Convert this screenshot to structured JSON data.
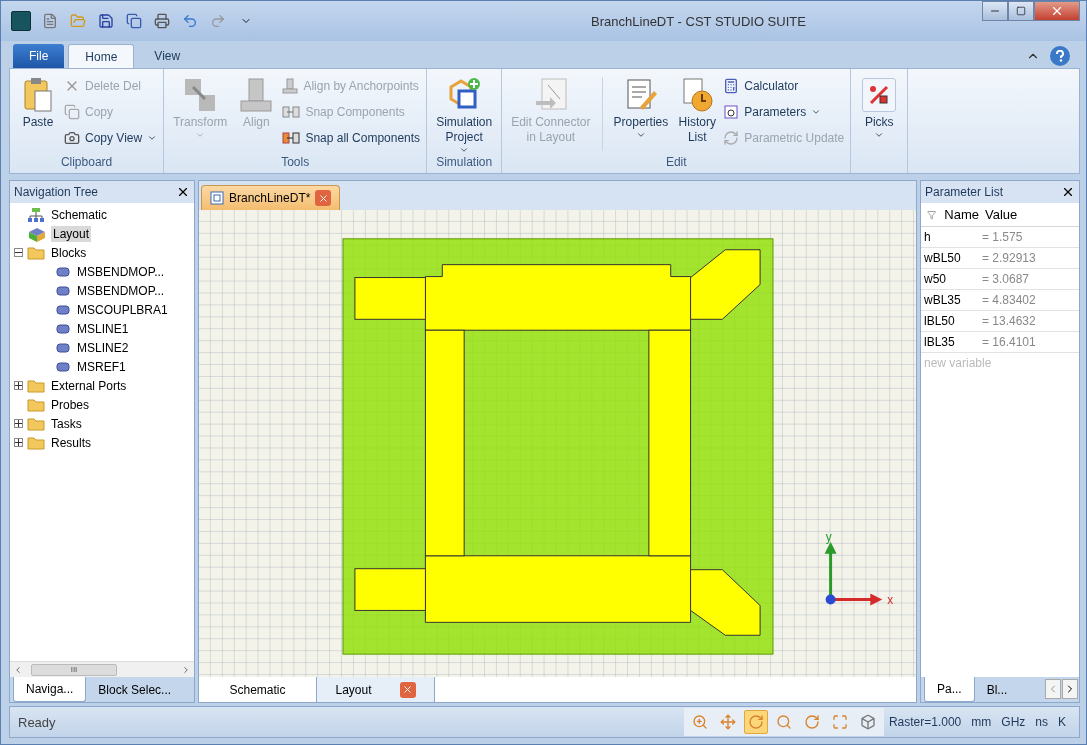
{
  "window": {
    "title": "BranchLineDT - CST STUDIO SUITE"
  },
  "ribbon_tabs": [
    {
      "label": "File",
      "kind": "file",
      "selected": false
    },
    {
      "label": "Home",
      "kind": "tab",
      "selected": true
    },
    {
      "label": "View",
      "kind": "tab",
      "selected": false
    }
  ],
  "ribbon_groups": [
    {
      "label": "Clipboard",
      "items": [
        {
          "kind": "large",
          "lines": [
            "Paste"
          ],
          "disabled": false,
          "dropdown": false
        },
        {
          "kind": "small",
          "label": "Delete Del",
          "disabled": true,
          "dropdown": false
        },
        {
          "kind": "small",
          "label": "Copy",
          "disabled": true,
          "dropdown": false
        },
        {
          "kind": "small",
          "label": "Copy View",
          "disabled": false,
          "dropdown": true
        }
      ]
    },
    {
      "label": "Tools",
      "items": [
        {
          "kind": "large",
          "lines": [
            "Transform"
          ],
          "disabled": true,
          "dropdown": true
        },
        {
          "kind": "large",
          "lines": [
            "Align"
          ],
          "disabled": true,
          "dropdown": false
        },
        {
          "kind": "small",
          "label": "Align by Anchorpoints",
          "disabled": true,
          "dropdown": false
        },
        {
          "kind": "small",
          "label": "Snap Components",
          "disabled": true,
          "dropdown": false
        },
        {
          "kind": "small",
          "label": "Snap all Components",
          "disabled": false,
          "dropdown": false
        }
      ]
    },
    {
      "label": "Simulation",
      "items": [
        {
          "kind": "large",
          "lines": [
            "Simulation",
            "Project"
          ],
          "disabled": false,
          "dropdown": true
        }
      ]
    },
    {
      "label": "Edit",
      "items": [
        {
          "kind": "large",
          "lines": [
            "Edit Connector",
            "in Layout"
          ],
          "disabled": true,
          "dropdown": false
        },
        {
          "kind": "separator"
        },
        {
          "kind": "large",
          "lines": [
            "Properties"
          ],
          "disabled": false,
          "dropdown": true
        },
        {
          "kind": "large",
          "lines": [
            "History",
            "List"
          ],
          "disabled": false,
          "dropdown": false
        },
        {
          "kind": "small",
          "label": "Calculator",
          "disabled": false,
          "dropdown": false
        },
        {
          "kind": "small",
          "label": "Parameters",
          "disabled": false,
          "dropdown": true
        },
        {
          "kind": "small",
          "label": "Parametric Update",
          "disabled": true,
          "dropdown": false
        }
      ]
    },
    {
      "items": [
        {
          "kind": "large",
          "lines": [
            "Picks"
          ],
          "disabled": false,
          "dropdown": true
        }
      ]
    }
  ],
  "navigation_tree": {
    "title": "Navigation Tree",
    "items": [
      {
        "kind": "schematic",
        "label": "Schematic",
        "selected": false
      },
      {
        "kind": "layout",
        "label": "Layout",
        "selected": true
      },
      {
        "kind": "folder",
        "label": "Blocks",
        "selected": false,
        "expanded": true,
        "children": [
          {
            "kind": "block",
            "label": "MSBENDMOP...",
            "selected": false
          },
          {
            "kind": "block",
            "label": "MSBENDMOP...",
            "selected": false
          },
          {
            "kind": "block",
            "label": "MSCOUPLBRA1",
            "selected": false
          },
          {
            "kind": "block",
            "label": "MSLINE1",
            "selected": false
          },
          {
            "kind": "block",
            "label": "MSLINE2",
            "selected": false
          },
          {
            "kind": "block",
            "label": "MSREF1",
            "selected": false
          }
        ]
      },
      {
        "kind": "folder",
        "label": "External Ports",
        "selected": false,
        "expanded": false
      },
      {
        "kind": "folder",
        "label": "Probes",
        "selected": false
      },
      {
        "kind": "folder",
        "label": "Tasks",
        "selected": false,
        "expanded": false
      },
      {
        "kind": "folder",
        "label": "Results",
        "selected": false,
        "expanded": false
      }
    ],
    "scroll_grip": "III",
    "tabs": [
      {
        "label": "Naviga...",
        "selected": true
      },
      {
        "label": "Block Selec...",
        "selected": false
      }
    ]
  },
  "document": {
    "tab": "BranchLineDT*",
    "axes": {
      "y": "y",
      "x": "x"
    },
    "view_tabs": [
      {
        "label": "Schematic",
        "selected": true,
        "closable": false
      },
      {
        "label": "Layout",
        "selected": false,
        "closable": true
      }
    ]
  },
  "parameter_list": {
    "title": "Parameter List",
    "columns": [
      "Name",
      "Value"
    ],
    "rows": [
      {
        "name": "h",
        "value": "= 1.575"
      },
      {
        "name": "wBL50",
        "value": "= 2.92913"
      },
      {
        "name": "w50",
        "value": "= 3.0687"
      },
      {
        "name": "wBL35",
        "value": "= 4.83402"
      },
      {
        "name": "lBL50",
        "value": "= 13.4632"
      },
      {
        "name": "lBL35",
        "value": "= 16.4101"
      }
    ],
    "placeholder": "new variable",
    "tabs": [
      {
        "label": "Pa...",
        "selected": true
      },
      {
        "label": "Bl...",
        "selected": false
      }
    ]
  },
  "status_bar": {
    "text": "Ready",
    "view_tools": [
      {
        "selected": false
      },
      {
        "selected": false
      },
      {
        "selected": true
      },
      {
        "selected": false
      },
      {
        "selected": false
      },
      {
        "selected": false
      },
      {
        "selected": false
      }
    ],
    "raster": "Raster=1.000",
    "units": [
      "mm",
      "GHz",
      "ns",
      "K"
    ]
  }
}
